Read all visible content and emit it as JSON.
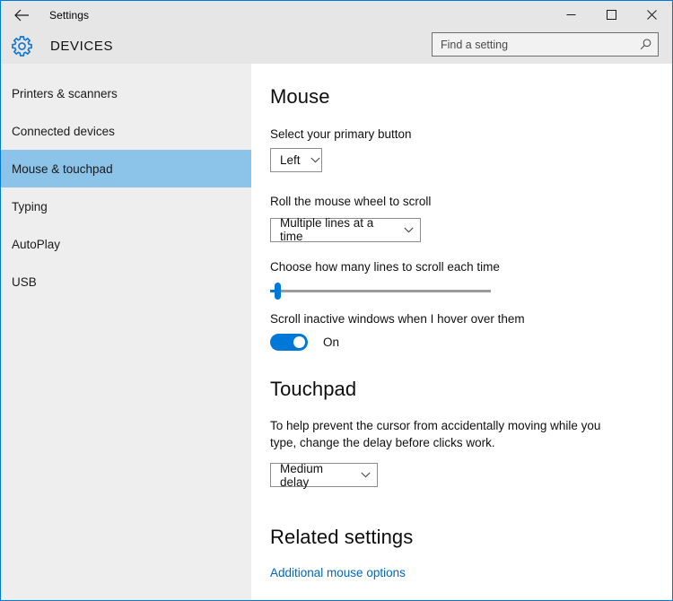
{
  "window": {
    "title": "Settings",
    "back_icon": "back-arrow-icon",
    "minimize_label": "─",
    "maximize_label": "□",
    "close_label": "✕"
  },
  "header": {
    "gear_icon": "gear-icon",
    "app_title": "DEVICES",
    "search": {
      "placeholder": "Find a setting",
      "value": "",
      "icon": "search-icon"
    }
  },
  "sidebar": {
    "items": [
      {
        "label": "Printers & scanners",
        "selected": false
      },
      {
        "label": "Connected devices",
        "selected": false
      },
      {
        "label": "Mouse & touchpad",
        "selected": true
      },
      {
        "label": "Typing",
        "selected": false
      },
      {
        "label": "AutoPlay",
        "selected": false
      },
      {
        "label": "USB",
        "selected": false
      }
    ]
  },
  "main": {
    "mouse": {
      "heading": "Mouse",
      "primary_button": {
        "label": "Select your primary button",
        "value": "Left",
        "chevron_icon": "chevron-down-icon"
      },
      "wheel": {
        "label": "Roll the mouse wheel to scroll",
        "value": "Multiple lines at a time",
        "chevron_icon": "chevron-down-icon"
      },
      "lines_slider": {
        "label": "Choose how many lines to scroll each time",
        "value": 3,
        "min": 1,
        "max": 100
      },
      "scroll_inactive": {
        "label": "Scroll inactive windows when I hover over them",
        "state": "On"
      }
    },
    "touchpad": {
      "heading": "Touchpad",
      "description": "To help prevent the cursor from accidentally moving while you type, change the delay before clicks work.",
      "delay": {
        "value": "Medium delay",
        "chevron_icon": "chevron-down-icon"
      }
    },
    "related": {
      "heading": "Related settings",
      "link_label": "Additional mouse options"
    }
  },
  "colors": {
    "accent": "#0078d7",
    "selection": "#8cc3e8",
    "link": "#0067c0",
    "chrome": "#e6e6e6",
    "sidebar": "#eeeeee"
  }
}
